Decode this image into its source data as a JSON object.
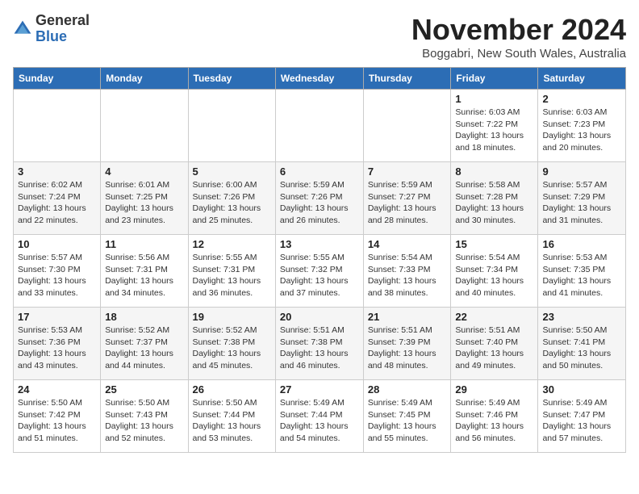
{
  "header": {
    "logo_general": "General",
    "logo_blue": "Blue",
    "month_title": "November 2024",
    "location": "Boggabri, New South Wales, Australia"
  },
  "weekdays": [
    "Sunday",
    "Monday",
    "Tuesday",
    "Wednesday",
    "Thursday",
    "Friday",
    "Saturday"
  ],
  "weeks": [
    [
      {
        "day": "",
        "info": ""
      },
      {
        "day": "",
        "info": ""
      },
      {
        "day": "",
        "info": ""
      },
      {
        "day": "",
        "info": ""
      },
      {
        "day": "",
        "info": ""
      },
      {
        "day": "1",
        "info": "Sunrise: 6:03 AM\nSunset: 7:22 PM\nDaylight: 13 hours and 18 minutes."
      },
      {
        "day": "2",
        "info": "Sunrise: 6:03 AM\nSunset: 7:23 PM\nDaylight: 13 hours and 20 minutes."
      }
    ],
    [
      {
        "day": "3",
        "info": "Sunrise: 6:02 AM\nSunset: 7:24 PM\nDaylight: 13 hours and 22 minutes."
      },
      {
        "day": "4",
        "info": "Sunrise: 6:01 AM\nSunset: 7:25 PM\nDaylight: 13 hours and 23 minutes."
      },
      {
        "day": "5",
        "info": "Sunrise: 6:00 AM\nSunset: 7:26 PM\nDaylight: 13 hours and 25 minutes."
      },
      {
        "day": "6",
        "info": "Sunrise: 5:59 AM\nSunset: 7:26 PM\nDaylight: 13 hours and 26 minutes."
      },
      {
        "day": "7",
        "info": "Sunrise: 5:59 AM\nSunset: 7:27 PM\nDaylight: 13 hours and 28 minutes."
      },
      {
        "day": "8",
        "info": "Sunrise: 5:58 AM\nSunset: 7:28 PM\nDaylight: 13 hours and 30 minutes."
      },
      {
        "day": "9",
        "info": "Sunrise: 5:57 AM\nSunset: 7:29 PM\nDaylight: 13 hours and 31 minutes."
      }
    ],
    [
      {
        "day": "10",
        "info": "Sunrise: 5:57 AM\nSunset: 7:30 PM\nDaylight: 13 hours and 33 minutes."
      },
      {
        "day": "11",
        "info": "Sunrise: 5:56 AM\nSunset: 7:31 PM\nDaylight: 13 hours and 34 minutes."
      },
      {
        "day": "12",
        "info": "Sunrise: 5:55 AM\nSunset: 7:31 PM\nDaylight: 13 hours and 36 minutes."
      },
      {
        "day": "13",
        "info": "Sunrise: 5:55 AM\nSunset: 7:32 PM\nDaylight: 13 hours and 37 minutes."
      },
      {
        "day": "14",
        "info": "Sunrise: 5:54 AM\nSunset: 7:33 PM\nDaylight: 13 hours and 38 minutes."
      },
      {
        "day": "15",
        "info": "Sunrise: 5:54 AM\nSunset: 7:34 PM\nDaylight: 13 hours and 40 minutes."
      },
      {
        "day": "16",
        "info": "Sunrise: 5:53 AM\nSunset: 7:35 PM\nDaylight: 13 hours and 41 minutes."
      }
    ],
    [
      {
        "day": "17",
        "info": "Sunrise: 5:53 AM\nSunset: 7:36 PM\nDaylight: 13 hours and 43 minutes."
      },
      {
        "day": "18",
        "info": "Sunrise: 5:52 AM\nSunset: 7:37 PM\nDaylight: 13 hours and 44 minutes."
      },
      {
        "day": "19",
        "info": "Sunrise: 5:52 AM\nSunset: 7:38 PM\nDaylight: 13 hours and 45 minutes."
      },
      {
        "day": "20",
        "info": "Sunrise: 5:51 AM\nSunset: 7:38 PM\nDaylight: 13 hours and 46 minutes."
      },
      {
        "day": "21",
        "info": "Sunrise: 5:51 AM\nSunset: 7:39 PM\nDaylight: 13 hours and 48 minutes."
      },
      {
        "day": "22",
        "info": "Sunrise: 5:51 AM\nSunset: 7:40 PM\nDaylight: 13 hours and 49 minutes."
      },
      {
        "day": "23",
        "info": "Sunrise: 5:50 AM\nSunset: 7:41 PM\nDaylight: 13 hours and 50 minutes."
      }
    ],
    [
      {
        "day": "24",
        "info": "Sunrise: 5:50 AM\nSunset: 7:42 PM\nDaylight: 13 hours and 51 minutes."
      },
      {
        "day": "25",
        "info": "Sunrise: 5:50 AM\nSunset: 7:43 PM\nDaylight: 13 hours and 52 minutes."
      },
      {
        "day": "26",
        "info": "Sunrise: 5:50 AM\nSunset: 7:44 PM\nDaylight: 13 hours and 53 minutes."
      },
      {
        "day": "27",
        "info": "Sunrise: 5:49 AM\nSunset: 7:44 PM\nDaylight: 13 hours and 54 minutes."
      },
      {
        "day": "28",
        "info": "Sunrise: 5:49 AM\nSunset: 7:45 PM\nDaylight: 13 hours and 55 minutes."
      },
      {
        "day": "29",
        "info": "Sunrise: 5:49 AM\nSunset: 7:46 PM\nDaylight: 13 hours and 56 minutes."
      },
      {
        "day": "30",
        "info": "Sunrise: 5:49 AM\nSunset: 7:47 PM\nDaylight: 13 hours and 57 minutes."
      }
    ]
  ]
}
